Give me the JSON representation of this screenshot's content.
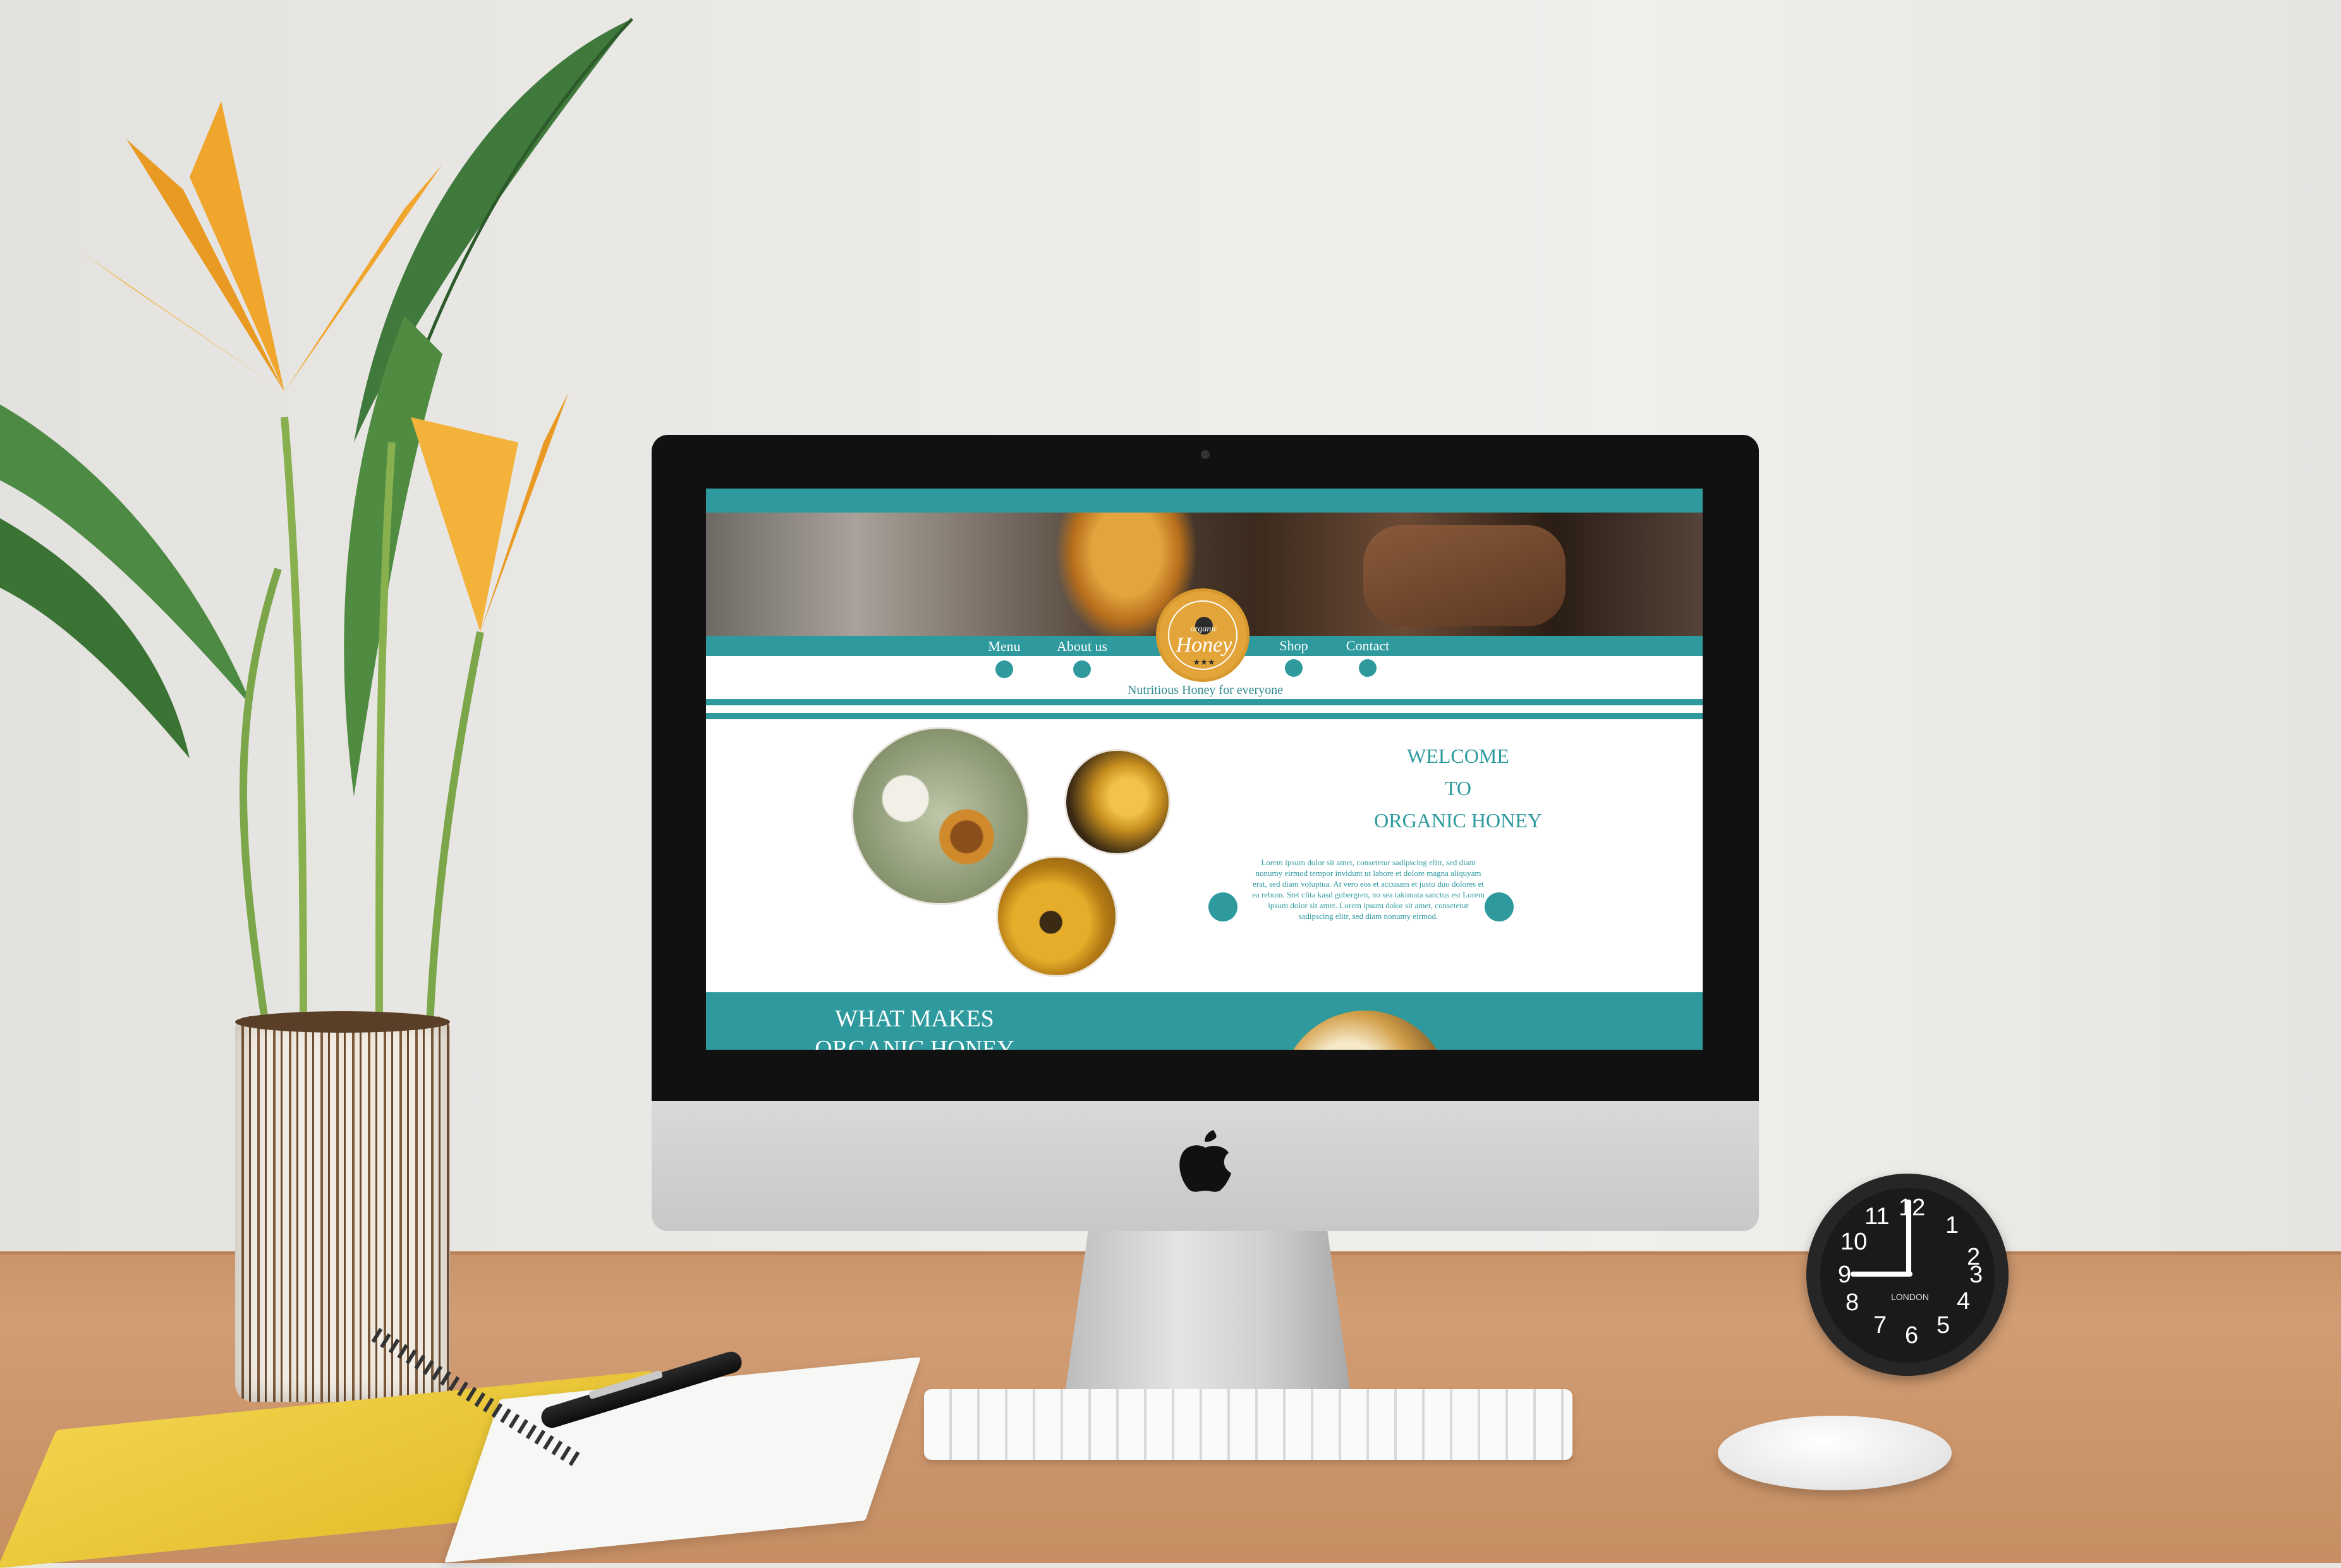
{
  "site": {
    "nav": {
      "items": [
        {
          "label": "Menu"
        },
        {
          "label": "About us"
        },
        {
          "label": "Shop"
        },
        {
          "label": "Contact"
        }
      ]
    },
    "logo": {
      "small_text": "organic",
      "main_text": "Honey",
      "stars": "★★★"
    },
    "tagline": "Nutritious Honey for everyone",
    "welcome": {
      "line1": "WELCOME",
      "line2": "TO",
      "line3": "ORGANIC HONEY"
    },
    "lorem": "Lorem ipsum dolor sit amet, consetetur sadipscing elitr, sed diam nonumy eirmod tempor invidunt ut labore et dolore magna aliquyam erat, sed diam voluptua. At vero eos et accusam et justo duo dolores et ea rebum. Stet clita kasd gubergren, no sea takimata sanctus est Lorem ipsum dolor sit amet. Lorem ipsum dolor sit amet, consetetur sadipscing elitr, sed diam nonumy eirmod.",
    "band_title": "WHAT MAKES ORGANIC HONEY DIFFERENT?"
  },
  "clock": {
    "numbers": [
      "12",
      "1",
      "2",
      "3",
      "4",
      "5",
      "6",
      "7",
      "8",
      "9",
      "10",
      "11"
    ],
    "brand": "LONDON"
  },
  "colors": {
    "accent": "#2e9a9e",
    "honey": "#e3a53a"
  },
  "icons": [
    "bee-icon",
    "apple-logo-icon",
    "arrow-left-icon",
    "arrow-right-icon"
  ]
}
